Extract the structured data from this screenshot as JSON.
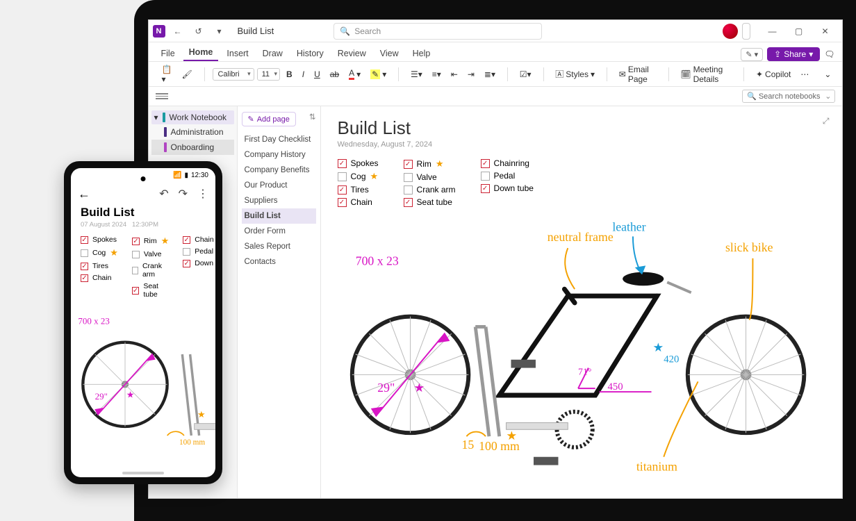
{
  "app": {
    "name": "OneNote",
    "logo_letter": "N",
    "title": "Build List"
  },
  "search": {
    "placeholder": "Search"
  },
  "window": {
    "min": "—",
    "max": "▢",
    "close": "✕"
  },
  "premium_icon": "◆",
  "tabs": {
    "file": "File",
    "home": "Home",
    "insert": "Insert",
    "draw": "Draw",
    "history": "History",
    "review": "Review",
    "view": "View",
    "help": "Help",
    "editing_mode": "Editing",
    "share": "Share"
  },
  "ribbon": {
    "font": "Calibri",
    "size": "11",
    "styles": "Styles",
    "email": "Email Page",
    "meeting": "Meeting Details",
    "copilot": "Copilot"
  },
  "search_nb": "Search notebooks",
  "tree": {
    "notebook": "Work Notebook",
    "s1": "Administration",
    "s2": "Onboarding"
  },
  "pages": {
    "add": "Add page",
    "p1": "First Day Checklist",
    "p2": "Company History",
    "p3": "Company Benefits",
    "p4": "Our Product",
    "p5": "Suppliers",
    "p6": "Build List",
    "p7": "Order Form",
    "p8": "Sales Report",
    "p9": "Contacts"
  },
  "page": {
    "title": "Build List",
    "date": "Wednesday, August 7, 2024",
    "c1": {
      "i1": "Spokes",
      "i2": "Cog",
      "i3": "Tires",
      "i4": "Chain"
    },
    "c2": {
      "i1": "Rim",
      "i2": "Valve",
      "i3": "Crank arm",
      "i4": "Seat tube"
    },
    "c3": {
      "i1": "Chainring",
      "i2": "Pedal",
      "i3": "Down tube"
    }
  },
  "ink": {
    "dim": "700 x 23",
    "wheel": "29\"",
    "crank": "100 mm",
    "fork_angle": "15",
    "frame_len": "450",
    "seat_angle": "71°",
    "seat_num": "420",
    "neutral": "neutral frame",
    "leather": "leather",
    "titanium": "titanium",
    "slick": "slick bike"
  },
  "phone": {
    "time": "12:30",
    "title": "Build List",
    "date": "07 August 2024",
    "time2": "12:30PM",
    "c1": {
      "i1": "Spokes",
      "i2": "Cog",
      "i3": "Tires",
      "i4": "Chain"
    },
    "c2": {
      "i1": "Rim",
      "i2": "Valve",
      "i3": "Crank arm",
      "i4": "Seat tube"
    },
    "c3": {
      "i1": "Chain",
      "i2": "Pedal",
      "i3": "Down"
    },
    "dim": "700 x 23",
    "wheel": "29\"",
    "crank": "100 mm"
  }
}
